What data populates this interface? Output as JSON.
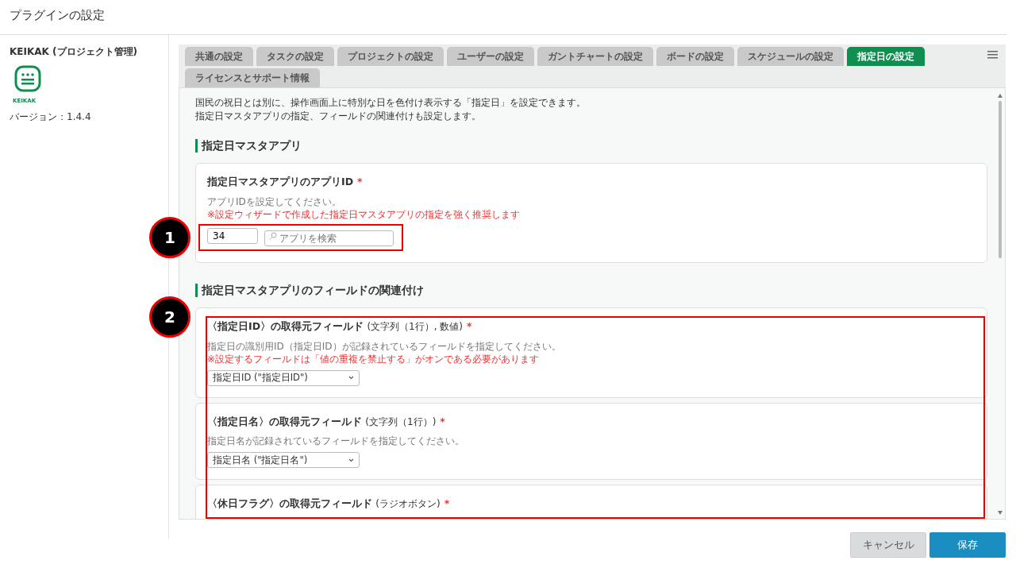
{
  "page_title": "プラグインの設定",
  "sidebar": {
    "plugin_name": "KEIKAK (プロジェクト管理)",
    "logo_text": "KEIKAK",
    "version": "バージョン：1.4.4"
  },
  "tabs": [
    {
      "label": "共通の設定",
      "selected": false
    },
    {
      "label": "タスクの設定",
      "selected": false
    },
    {
      "label": "プロジェクトの設定",
      "selected": false
    },
    {
      "label": "ユーザーの設定",
      "selected": false
    },
    {
      "label": "ガントチャートの設定",
      "selected": false
    },
    {
      "label": "ボードの設定",
      "selected": false
    },
    {
      "label": "スケジュールの設定",
      "selected": false
    },
    {
      "label": "指定日の設定",
      "selected": true
    },
    {
      "label": "ライセンスとサポート情報",
      "selected": false
    }
  ],
  "intro": [
    "国民の祝日とは別に、操作画面上に特別な日を色付け表示する「指定日」を設定できます。",
    "指定日マスタアプリの指定、フィールドの関連付けも設定します。"
  ],
  "sections": [
    {
      "heading": "指定日マスタアプリ",
      "cards": [
        {
          "kind": "app",
          "title": "指定日マスタアプリのアプリID",
          "required_mark": "*",
          "help": "アプリIDを設定してください。",
          "warning": "※設定ウィザードで作成した指定日マスタアプリの指定を強く推奨します",
          "value": "34",
          "placeholder": "アプリを検索",
          "callout": "1"
        }
      ]
    },
    {
      "heading": "指定日マスタアプリのフィールドの関連付け",
      "callout": "2",
      "cards": [
        {
          "kind": "select",
          "title": "〈指定日ID〉の取得元フィールド",
          "type_note": "(文字列（1行）, 数値)",
          "required_mark": "*",
          "help": "指定日の識別用ID（指定日ID）が記録されているフィールドを指定してください。",
          "warning": "※設定するフィールドは「値の重複を禁止する」がオンである必要があります",
          "value": "指定日ID (\"指定日ID\")"
        },
        {
          "kind": "select",
          "title": "〈指定日名〉の取得元フィールド",
          "type_note": "(文字列（1行）)",
          "required_mark": "*",
          "help": "指定日名が記録されているフィールドを指定してください。",
          "value": "指定日名 (\"指定日名\")"
        },
        {
          "kind": "select",
          "title": "〈休日フラグ〉の取得元フィールド",
          "type_note": "(ラジオボタン)",
          "required_mark": "*"
        }
      ]
    }
  ],
  "buttons": [
    {
      "label": "キャンセル",
      "kind": "secondary"
    },
    {
      "label": "保存",
      "kind": "primary"
    }
  ]
}
